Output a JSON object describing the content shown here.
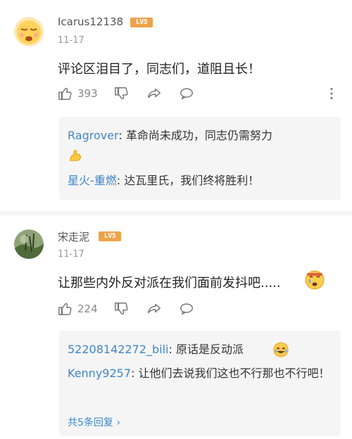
{
  "comments": [
    {
      "username": "Icarus12138",
      "level": "LV5",
      "date": "11-17",
      "text": "评论区泪目了，同志们，道阻且长！",
      "likes": "393",
      "replies": [
        {
          "name": "Ragrover",
          "sep": ": ",
          "text": "革命尚未成功，同志仍需努力"
        },
        {
          "name": "星火-重燃",
          "sep": ": ",
          "text": "达瓦里氏，我们终将胜利！"
        }
      ]
    },
    {
      "username": "宋走泥",
      "level": "LV5",
      "date": "11-17",
      "text": "让那些内外反对派在我们面前发抖吧.....",
      "likes": "224",
      "replies": [
        {
          "name": "52208142272_bili",
          "sep": ": ",
          "text": "原话是反动派"
        },
        {
          "name": "Kenny9257",
          "sep": ": ",
          "text": "让他们去说我们这也不行那也不行吧！"
        }
      ],
      "more_replies": "共5条回复 ›"
    }
  ],
  "icons": [
    "avatar",
    "level-badge",
    "thumb-up-icon",
    "thumb-down-icon",
    "share-icon",
    "reply-icon",
    "more-icon",
    "flexed-biceps-emoji",
    "tearful-emoji",
    "laughing-emoji"
  ],
  "colors": {
    "name_blue": "#3f86c8",
    "badge_orange": "#f0a24a",
    "gray": "#999999"
  }
}
